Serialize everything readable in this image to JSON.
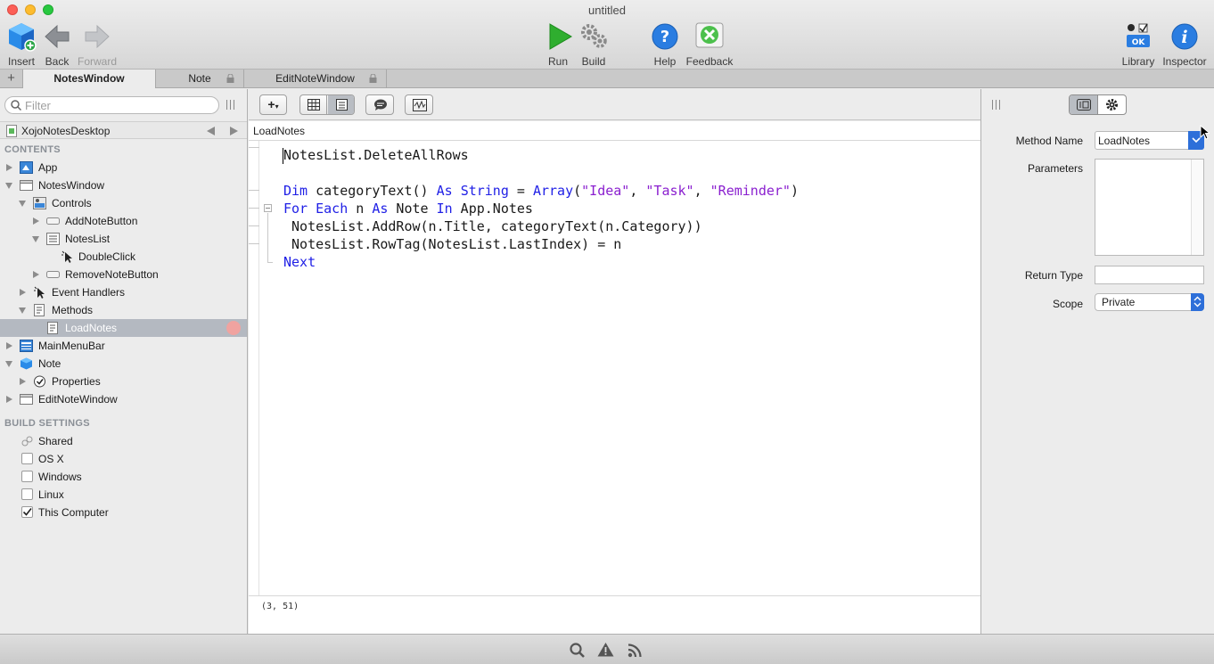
{
  "window": {
    "title": "untitled"
  },
  "toolbar": {
    "insert": "Insert",
    "back": "Back",
    "forward": "Forward",
    "run": "Run",
    "build": "Build",
    "help": "Help",
    "feedback": "Feedback",
    "library": "Library",
    "inspector": "Inspector"
  },
  "tabs": [
    {
      "label": "NotesWindow",
      "active": true
    },
    {
      "label": "Note",
      "locked": true
    },
    {
      "label": "EditNoteWindow",
      "locked": true
    }
  ],
  "sidebar": {
    "filter_placeholder": "Filter",
    "project": "XojoNotesDesktop",
    "contents_header": "CONTENTS",
    "items": [
      {
        "label": "App"
      },
      {
        "label": "NotesWindow"
      },
      {
        "label": "Controls"
      },
      {
        "label": "AddNoteButton"
      },
      {
        "label": "NotesList"
      },
      {
        "label": "DoubleClick"
      },
      {
        "label": "RemoveNoteButton"
      },
      {
        "label": "Event Handlers"
      },
      {
        "label": "Methods"
      },
      {
        "label": "LoadNotes"
      },
      {
        "label": "MainMenuBar"
      },
      {
        "label": "Note"
      },
      {
        "label": "Properties"
      },
      {
        "label": "EditNoteWindow"
      }
    ],
    "build_header": "BUILD SETTINGS",
    "build_items": [
      {
        "label": "Shared"
      },
      {
        "label": "OS X",
        "checked": false
      },
      {
        "label": "Windows",
        "checked": false
      },
      {
        "label": "Linux",
        "checked": false
      },
      {
        "label": "This Computer",
        "checked": true
      }
    ]
  },
  "editor": {
    "breadcrumb": "LoadNotes",
    "add_button": "+",
    "status": "(3, 51)",
    "code": {
      "l1": "NotesList.DeleteAllRows",
      "l3_dim": "Dim",
      "l3_a": " categoryText() ",
      "l3_as": "As",
      "l3_b": " ",
      "l3_string": "String",
      "l3_c": " = ",
      "l3_array": "Array",
      "l3_d": "(",
      "l3_s1": "\"Idea\"",
      "l3_e": ", ",
      "l3_s2": "\"Task\"",
      "l3_f": ", ",
      "l3_s3": "\"Reminder\"",
      "l3_g": ")",
      "l4_for": "For",
      "l4_a": " ",
      "l4_each": "Each",
      "l4_b": " n ",
      "l4_as": "As",
      "l4_c": " Note ",
      "l4_in": "In",
      "l4_d": " App.Notes",
      "l5": " NotesList.AddRow(n.Title, categoryText(n.Category))",
      "l6": " NotesList.RowTag(NotesList.LastIndex) = n",
      "l7": "Next"
    }
  },
  "inspector": {
    "method_name_label": "Method Name",
    "method_name_value": "LoadNotes",
    "parameters_label": "Parameters",
    "return_type_label": "Return Type",
    "scope_label": "Scope",
    "scope_value": "Private"
  },
  "colors": {
    "accent": "#2d6fd9",
    "keyword": "#1f1fe6",
    "string": "#8a1fcf",
    "breakpoint": "#f0a3a0"
  }
}
